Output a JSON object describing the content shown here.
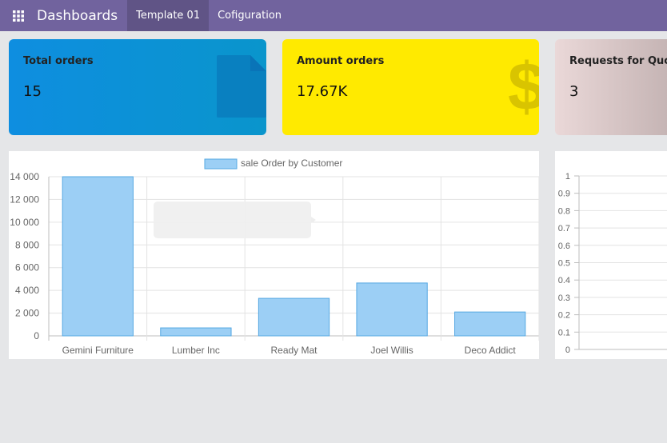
{
  "navbar": {
    "title": "Dashboards",
    "menu": [
      {
        "label": "Template 01",
        "active": true
      },
      {
        "label": "Cofiguration",
        "active": false
      }
    ],
    "background": "#71639e"
  },
  "kpis": [
    {
      "label": "Total orders",
      "value": "15",
      "color": "#0e8ee0",
      "icon": "document-icon"
    },
    {
      "label": "Amount orders",
      "value": "17.67K",
      "color": "#ffea00",
      "icon": "dollar-icon"
    },
    {
      "label": "Requests for Quota",
      "value": "3",
      "color": "#ead8d8",
      "icon": "none"
    }
  ],
  "chart_data": [
    {
      "type": "bar",
      "legend": "sale Order by Customer",
      "categories": [
        "Gemini Furniture",
        "Lumber Inc",
        "Ready Mat",
        "Joel Willis",
        "Deco Addict"
      ],
      "values": [
        14000,
        700,
        3300,
        4650,
        2100
      ],
      "y_ticks": [
        "0",
        "2 000",
        "4 000",
        "6 000",
        "8 000",
        "10 000",
        "12 000",
        "14 000"
      ],
      "ylim": [
        0,
        14000
      ],
      "bar_color": "#9ccff5",
      "bar_border": "#56a8e2",
      "grid": true
    },
    {
      "type": "bar",
      "categories": [],
      "values": [],
      "y_ticks": [
        "0",
        "0.1",
        "0.2",
        "0.3",
        "0.4",
        "0.5",
        "0.6",
        "0.7",
        "0.8",
        "0.9",
        "1"
      ],
      "ylim": [
        0,
        1
      ],
      "grid": true
    }
  ]
}
